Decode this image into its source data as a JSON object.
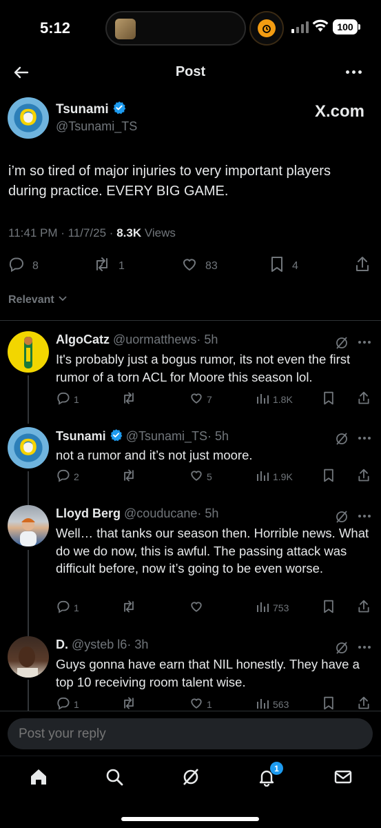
{
  "status_bar": {
    "time": "5:12",
    "battery": "100"
  },
  "header": {
    "title": "Post"
  },
  "post": {
    "author_name": "Tsunami",
    "author_handle": "@Tsunami_TS",
    "source_label": "X.com",
    "text": "i’m so tired of major injuries to very important players during practice. EVERY BIG GAME.",
    "time_date": "11:41 PM · 11/7/25 · ",
    "views_count": "8.3K",
    "views_label": " Views",
    "replies": "8",
    "reposts": "1",
    "likes": "83",
    "bookmarks": "4",
    "sort_label": "Relevant"
  },
  "replies": [
    {
      "name": "AlgoCatz",
      "handle": "@uormatthews",
      "time": "· 5h",
      "text": "It's probably just a bogus rumor, its not even the first rumor of a torn ACL for Moore this season lol.",
      "replies": "1",
      "reposts": "",
      "likes": "7",
      "views": "1.8K",
      "verified": false
    },
    {
      "name": "Tsunami",
      "handle": "@Tsunami_TS",
      "time": "· 5h",
      "text": "not a rumor and it’s not just moore.",
      "replies": "2",
      "reposts": "",
      "likes": "5",
      "views": "1.9K",
      "verified": true
    },
    {
      "name": "Lloyd Berg",
      "handle": "@couducane",
      "time": "· 5h",
      "text": "Well… that tanks our season then. Horrible news. What do we do now, this is awful. The passing attack was difficult before, now it’s going to be even worse.",
      "replies": "1",
      "reposts": "",
      "likes": "",
      "views": "753",
      "verified": false
    },
    {
      "name": "D.",
      "handle": "@ysteb l6",
      "time": "· 3h",
      "text": "Guys gonna have earn that NIL honestly. They have a top 10 receiving room talent wise.",
      "replies": "1",
      "reposts": "",
      "likes": "1",
      "views": "563",
      "verified": false
    }
  ],
  "composer": {
    "placeholder": "Post your reply"
  },
  "tabbar": {
    "notifications_badge": "1"
  },
  "icons": {
    "back": "arrow-left-icon",
    "more": "more-horizontal-icon",
    "verified": "verified-badge-icon",
    "reply": "reply-icon",
    "repost": "repost-icon",
    "like": "heart-icon",
    "bookmark": "bookmark-icon",
    "share": "share-icon",
    "views": "views-chart-icon",
    "grok": "grok-icon",
    "home": "home-icon",
    "search": "search-icon",
    "notifications": "bell-icon",
    "messages": "mail-icon",
    "timer": "alarm-clock-icon"
  },
  "colors": {
    "accent": "#1d9bf0",
    "muted": "#71767b",
    "text": "#e7e9ea",
    "background": "#000000"
  }
}
